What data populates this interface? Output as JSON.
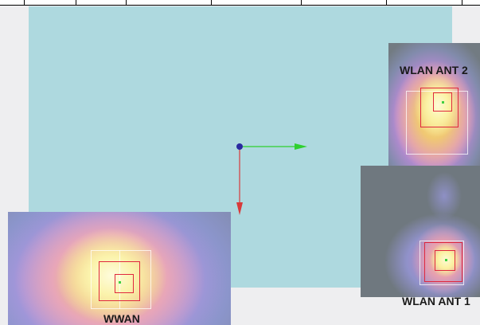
{
  "heatmaps": {
    "wlan_ant2": {
      "label": "WLAN ANT 2"
    },
    "wlan_ant1": {
      "label": "WLAN ANT 1"
    },
    "wwan": {
      "label": "WWAN"
    }
  },
  "colors": {
    "board": "#aed9df",
    "background": "#eeeef0",
    "x_axis": "#2fd02f",
    "y_axis": "#d83a3a",
    "origin": "#2a2aa0",
    "marker": "#e0283e"
  }
}
